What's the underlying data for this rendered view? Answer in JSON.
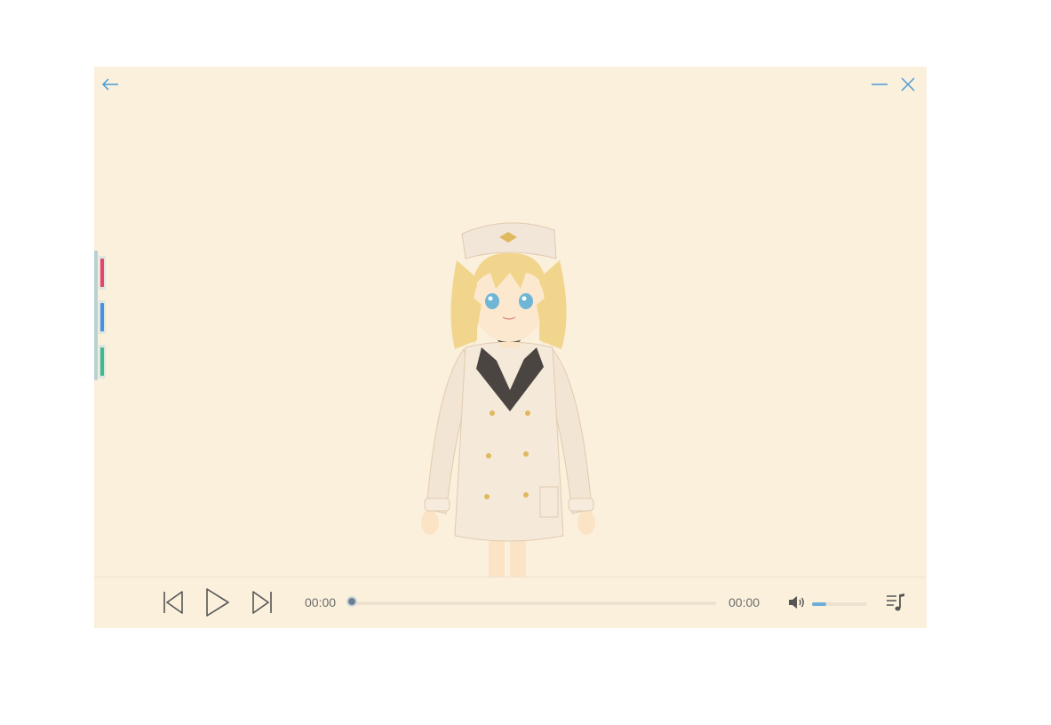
{
  "window": {
    "background": "#fbf0dc",
    "accent": "#4a9bd8"
  },
  "titlebar": {
    "back_icon": "arrow-left-icon",
    "minimize_icon": "minimize-icon",
    "close_icon": "close-icon"
  },
  "side_dock": {
    "tabs": [
      {
        "icon": "tab-marker-icon",
        "color": "#e8446a"
      },
      {
        "icon": "tab-marker-icon",
        "color": "#4a90e2"
      },
      {
        "icon": "tab-marker-icon",
        "color": "#3dbb8e"
      }
    ]
  },
  "stage": {
    "character": "anime-girl-illustration"
  },
  "player": {
    "current_time": "00:00",
    "total_time": "00:00",
    "progress": 0,
    "volume": 0.25,
    "prev_icon": "skip-previous-icon",
    "play_icon": "play-icon",
    "next_icon": "skip-next-icon",
    "volume_icon": "volume-icon",
    "playlist_icon": "playlist-icon"
  }
}
